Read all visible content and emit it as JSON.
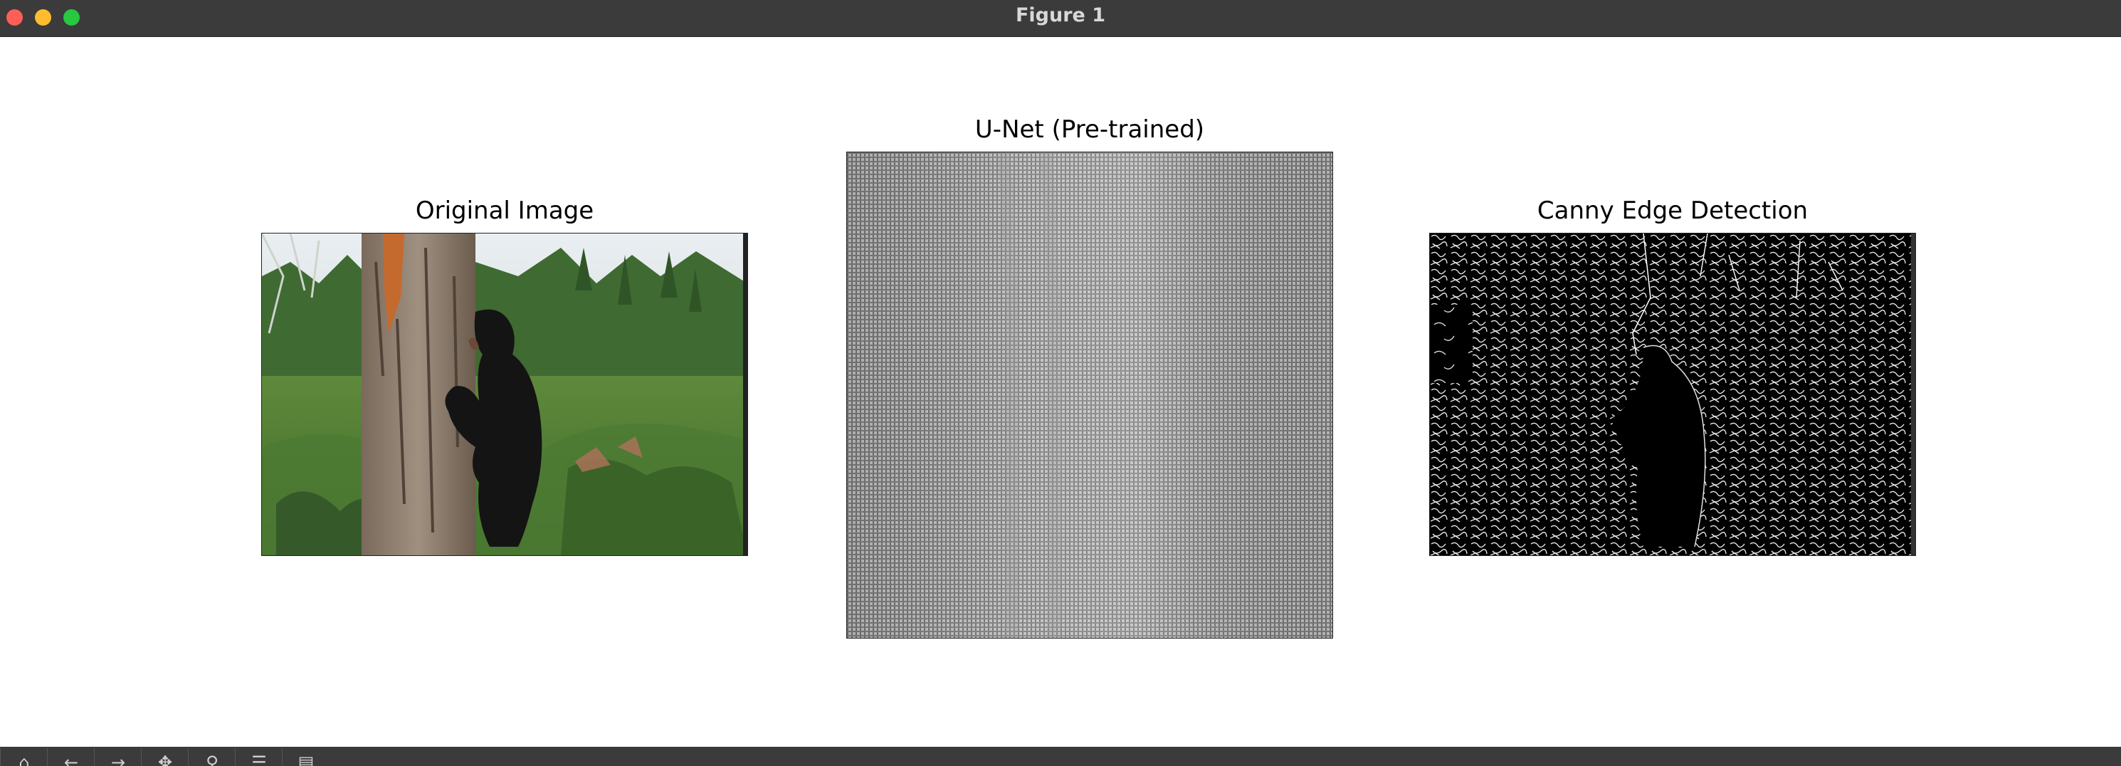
{
  "window": {
    "title": "Figure 1"
  },
  "figure": {
    "panels": [
      {
        "title": "Original Image"
      },
      {
        "title": "U-Net (Pre-trained)"
      },
      {
        "title": "Canny Edge Detection"
      }
    ]
  },
  "toolbar": {
    "buttons": [
      {
        "icon": "home-icon",
        "glyph": "⌂"
      },
      {
        "icon": "back-arrow-icon",
        "glyph": "←"
      },
      {
        "icon": "forward-arrow-icon",
        "glyph": "→"
      },
      {
        "icon": "pan-icon",
        "glyph": "✥"
      },
      {
        "icon": "zoom-icon",
        "glyph": "⚲"
      },
      {
        "icon": "configure-subplots-icon",
        "glyph": "☰"
      },
      {
        "icon": "save-icon",
        "glyph": "▤"
      }
    ]
  }
}
